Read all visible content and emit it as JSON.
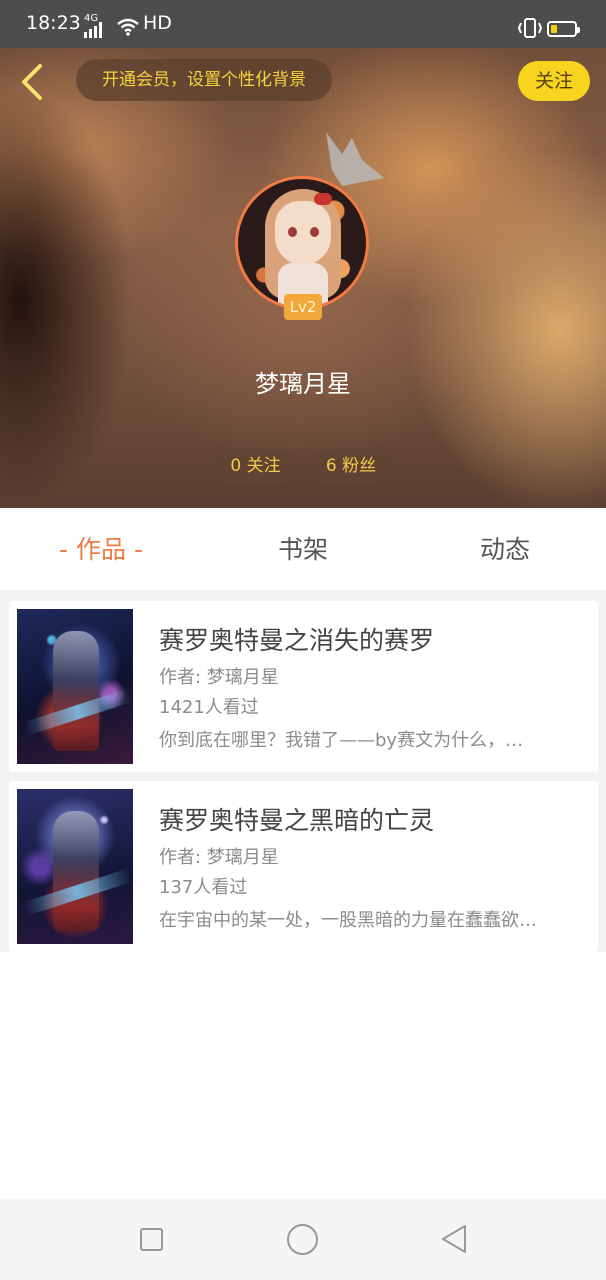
{
  "status_bar": {
    "time": "18:23",
    "network": "4G",
    "hd": "HD",
    "battery_level": 0.25,
    "battery_color": "#f2d11a"
  },
  "header": {
    "back_icon": "chevron-left-icon",
    "vip_banner": "开通会员，设置个性化背景",
    "follow_label": "关注",
    "accent_color": "#f7d51e"
  },
  "profile": {
    "crown_icon": "crown-icon",
    "level": "Lv2",
    "nickname": "梦璃月星",
    "following": "0 关注",
    "fans": "6 粉丝",
    "avatar_ring_color": "#f07b43"
  },
  "tabs": [
    {
      "label": "- 作品 -",
      "active": true
    },
    {
      "label": "书架",
      "active": false
    },
    {
      "label": "动态",
      "active": false
    }
  ],
  "works": [
    {
      "title": "赛罗奥特曼之消失的赛罗",
      "author": "作者: 梦璃月星",
      "views": "1421人看过",
      "description": "你到底在哪里？我错了——by赛文为什么，…"
    },
    {
      "title": "赛罗奥特曼之黑暗的亡灵",
      "author": "作者: 梦璃月星",
      "views": "137人看过",
      "description": "在宇宙中的某一处，一股黑暗的力量在蠢蠢欲…"
    }
  ],
  "nav_bar": {
    "recents_icon": "square-icon",
    "home_icon": "circle-icon",
    "back_icon": "triangle-back-icon"
  }
}
